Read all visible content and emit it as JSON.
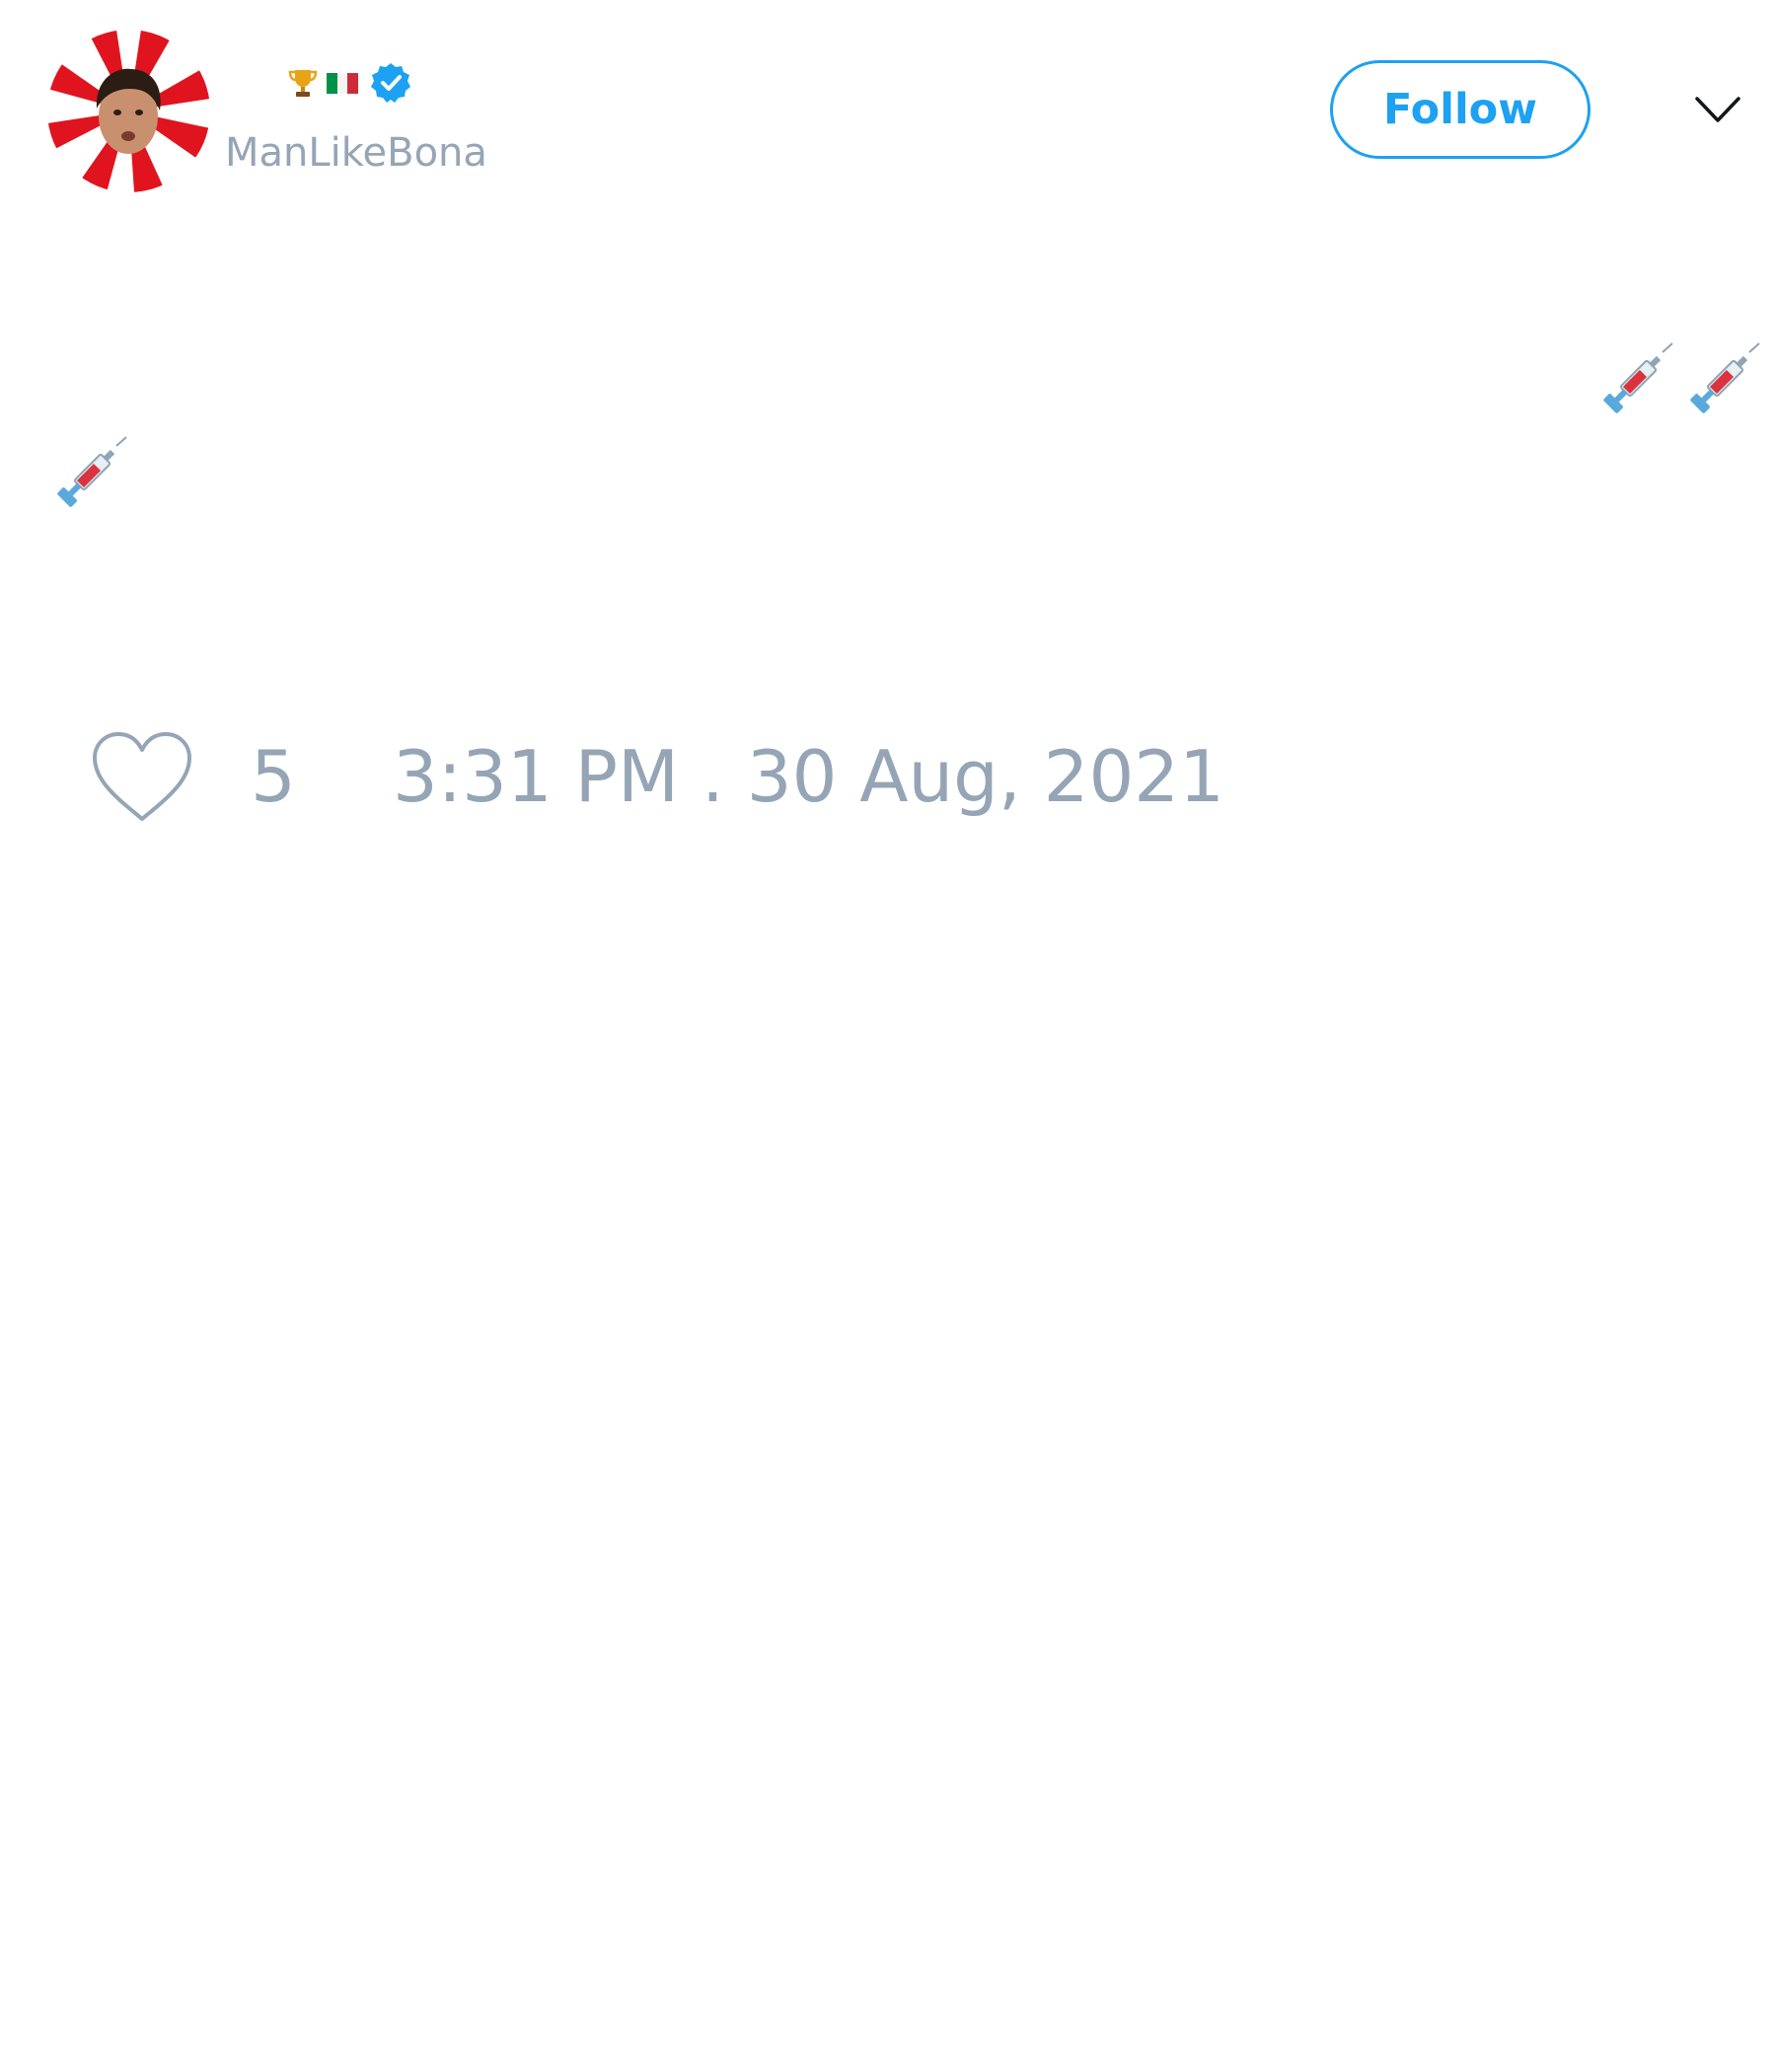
{
  "author": {
    "badges": [
      "trophy-icon",
      "italy-flag-icon",
      "verified-badge-icon"
    ],
    "handle": "ManLikeBona"
  },
  "header": {
    "follow_label": "Follow",
    "menu_icon": "chevron-down-icon"
  },
  "tweet": {
    "text_emojis": [
      "syringe-icon",
      "syringe-icon",
      "syringe-icon"
    ]
  },
  "footer": {
    "like_icon": "heart-icon",
    "like_count": "5",
    "timestamp": "3:31 PM . 30 Aug, 2021"
  },
  "colors": {
    "accent": "#1da1f2",
    "muted_text": "#95a5b6",
    "avatar_red": "#e0141e"
  }
}
